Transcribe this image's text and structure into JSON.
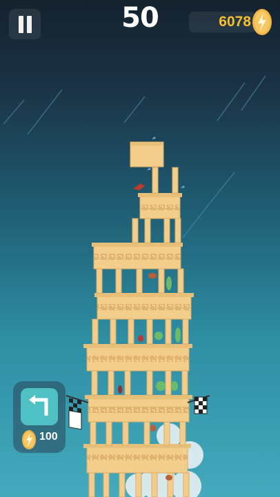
{
  "hud": {
    "score": "50",
    "coins": "6078",
    "coin_icon": "lightning-coin-icon",
    "pause_icon": "pause-icon"
  },
  "undo": {
    "icon": "undo-arrow-icon",
    "cost": "100"
  },
  "colors": {
    "stone": "#f2cd8c",
    "stone_dark": "#d9ac64",
    "coin": "#f4c12e",
    "undo_button": "#4fc1c4"
  }
}
